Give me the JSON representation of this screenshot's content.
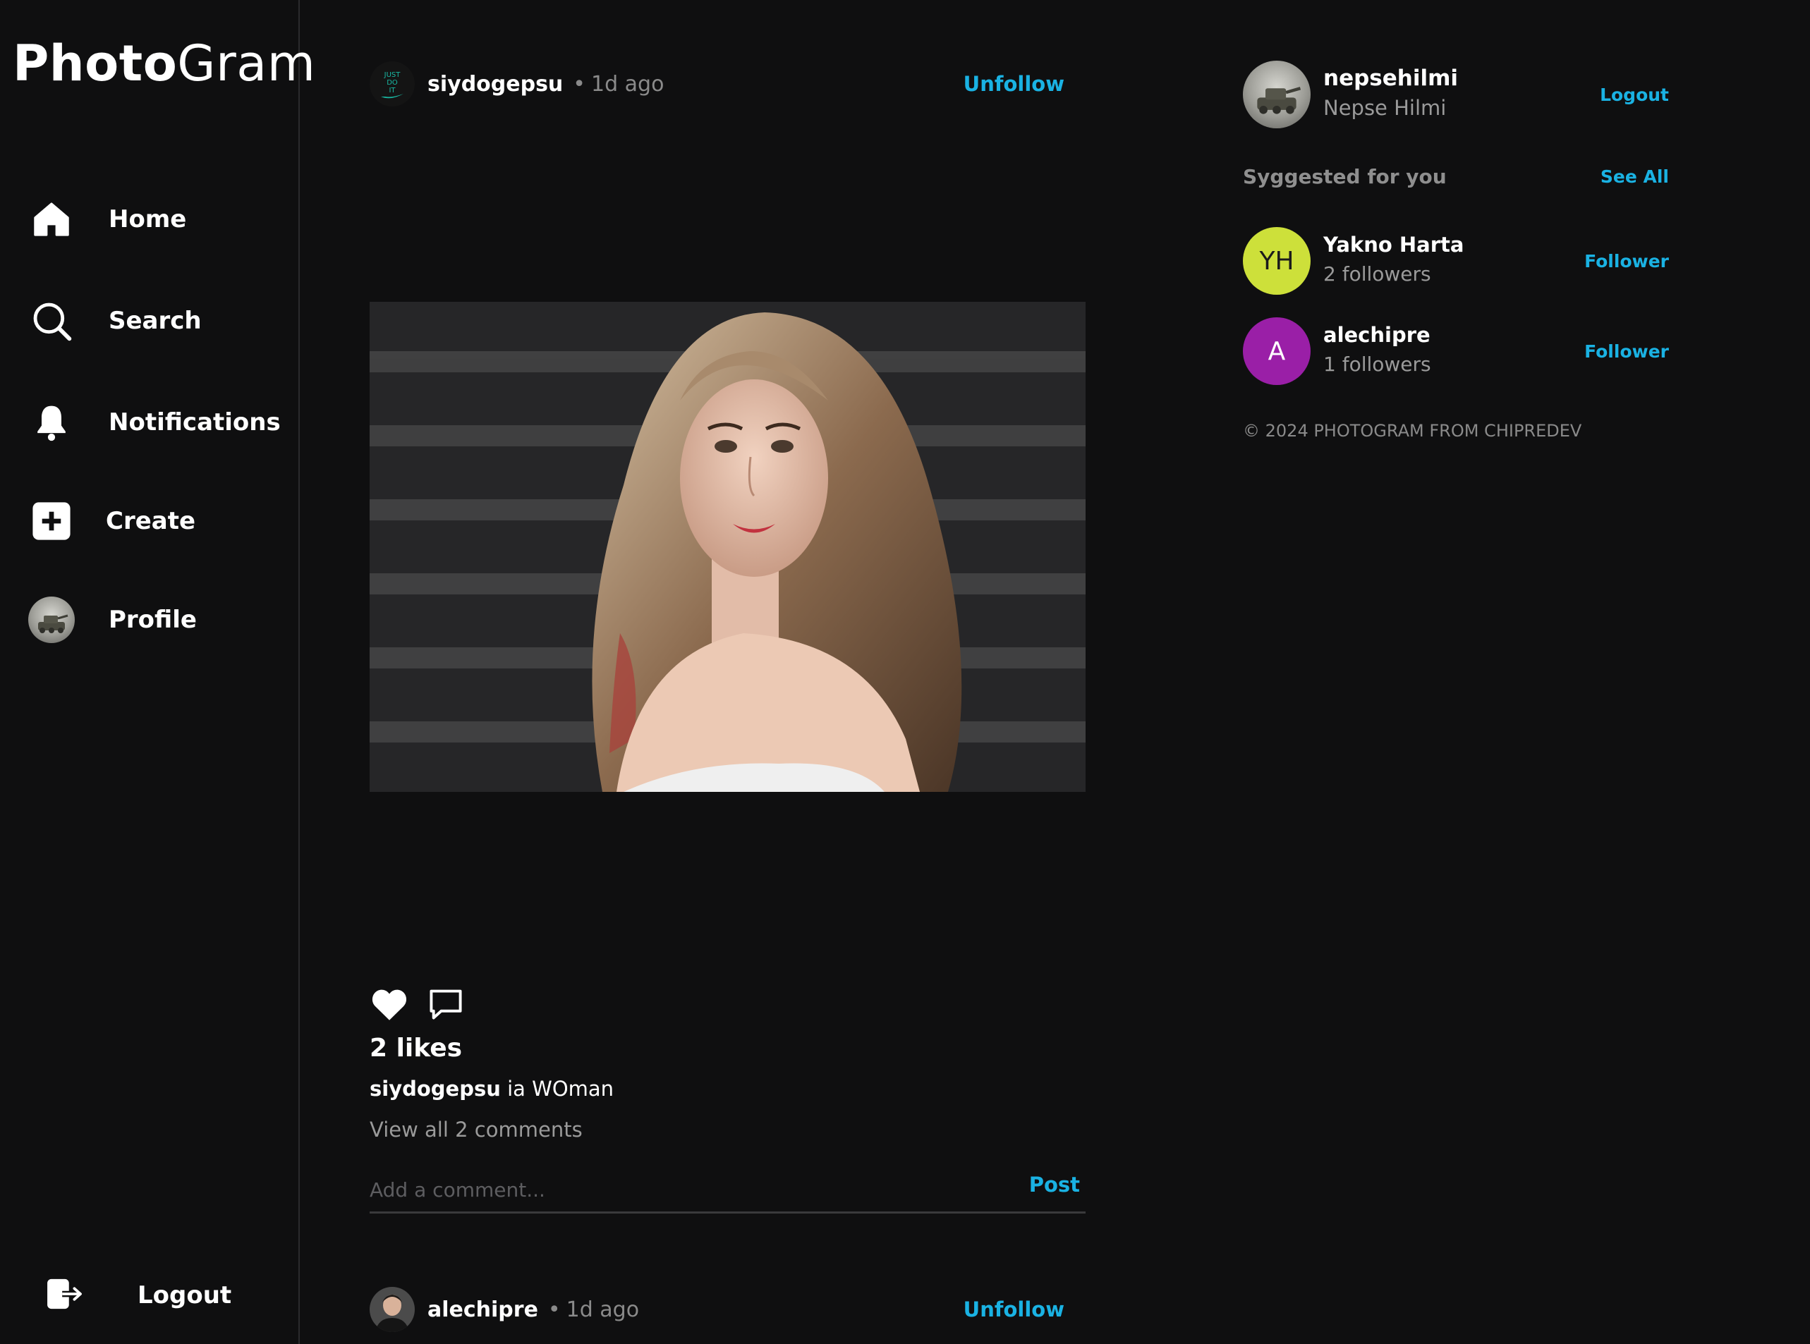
{
  "app": {
    "logo_bold": "Photo",
    "logo_thin": "Gram"
  },
  "sidebar": {
    "items": [
      {
        "label": "Home",
        "icon": "home-icon"
      },
      {
        "label": "Search",
        "icon": "search-icon"
      },
      {
        "label": "Notifications",
        "icon": "bell-icon"
      },
      {
        "label": "Create",
        "icon": "plus-square-icon"
      },
      {
        "label": "Profile",
        "icon": "profile-avatar"
      }
    ],
    "logout_label": "Logout"
  },
  "feed": {
    "post1": {
      "username": "siydogepsu",
      "dot": "•",
      "time": "1d ago",
      "follow_label": "Unfollow",
      "likes": "2 likes",
      "caption_user": "siydogepsu",
      "caption_text": "ia WOman",
      "view_comments": "View all 2 comments",
      "avatar_text": "JUST DO IT"
    },
    "comment": {
      "placeholder": "Add a comment...",
      "post_label": "Post"
    },
    "post2": {
      "username": "alechipre",
      "dot": "•",
      "time": "1d ago",
      "follow_label": "Unfollow"
    }
  },
  "right_panel": {
    "current_user": {
      "username": "nepsehilmi",
      "full_name": "Nepse Hilmi",
      "logout_label": "Logout"
    },
    "suggested_title": "Syggested for you",
    "see_all_label": "See All",
    "suggestions": [
      {
        "initials": "YH",
        "name": "Yakno Harta",
        "followers": "2 followers",
        "button": "Follower",
        "color": "#cde03a",
        "text_color": "#1b1b1b"
      },
      {
        "initials": "A",
        "name": "alechipre",
        "followers": "1 followers",
        "button": "Follower",
        "color": "#9a1fa7",
        "text_color": "#ffffff"
      }
    ],
    "footer": "© 2024 PHOTOGRAM FROM CHIPREDEV"
  },
  "colors": {
    "background": "#0f0f10",
    "accent": "#1ab2e3",
    "muted": "#9a9a9a"
  }
}
